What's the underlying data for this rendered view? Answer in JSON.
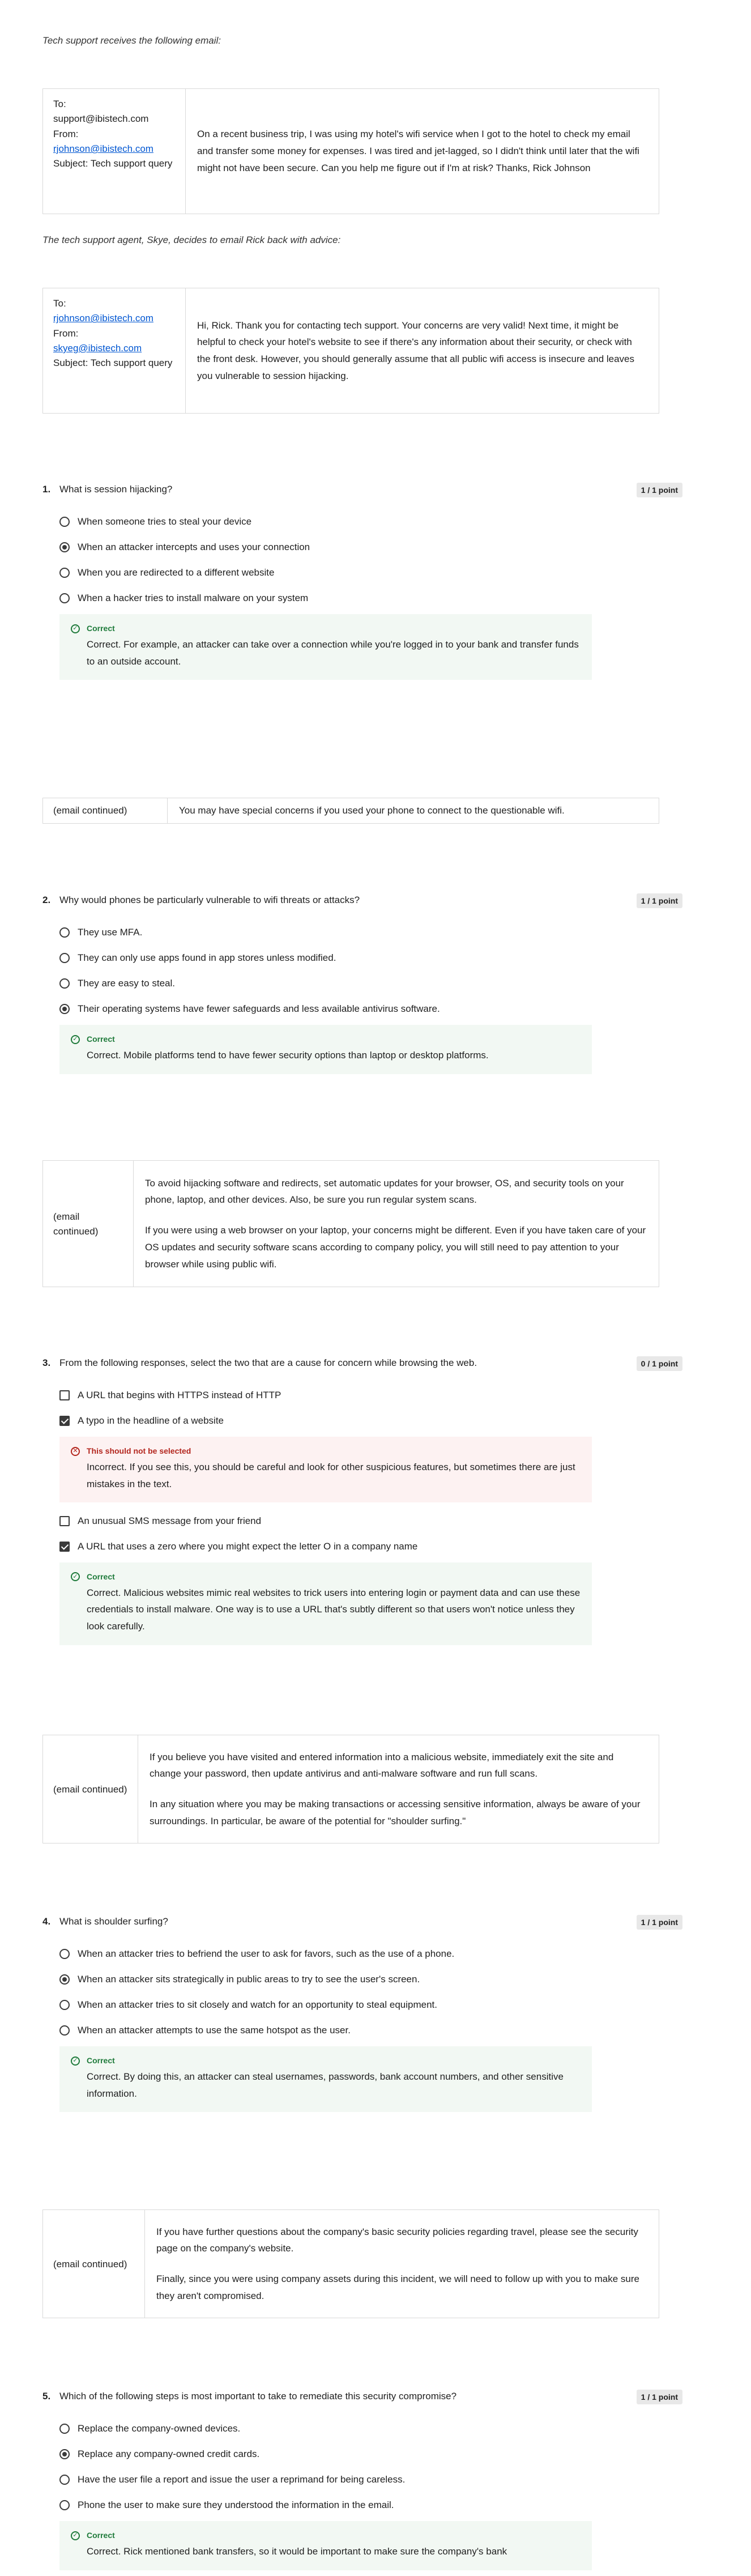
{
  "intro1": "Tech support receives the following email:",
  "email1": {
    "to": "To:",
    "to_addr": "support@ibistech.com",
    "from": "From:",
    "from_addr": "rjohnson@ibistech.com",
    "subject": "Subject: Tech support query",
    "body": "On a recent business trip, I was using my hotel's wifi service when I got to the hotel to check my email and transfer some money for expenses. I was tired and jet-lagged, so I didn't think until later that the wifi might not have been secure. Can you help me figure out if I'm at risk? Thanks, Rick Johnson"
  },
  "intro2": "The tech support agent, Skye, decides to email Rick back with advice:",
  "email2": {
    "to": "To:",
    "to_addr": "rjohnson@ibistech.com",
    "from": "From:",
    "from_addr": "skyeg@ibistech.com",
    "subject": "Subject: Tech support query",
    "body": "Hi, Rick. Thank you for contacting tech support. Your concerns are very valid! Next time, it might be helpful to check your hotel's website to see if there's any information about their security, or check with the front desk. However, you should generally assume that all public wifi access is insecure and leaves you vulnerable to session hijacking."
  },
  "q1": {
    "num": "1.",
    "text": "What is session hijacking?",
    "score": "1 / 1 point",
    "options": [
      "When someone tries to steal your device",
      "When an attacker intercepts and uses your connection",
      "When you are redirected to a different website",
      "When a hacker tries to install malware on your system"
    ],
    "fb_title": "Correct",
    "fb_text": "Correct. For example, an attacker can take over a connection while you're logged in to your bank and transfer funds to an outside account."
  },
  "cont1": {
    "label": "(email continued)",
    "body": "You may have special concerns if you used your phone to connect to the questionable wifi."
  },
  "q2": {
    "num": "2.",
    "text": "Why would phones be particularly vulnerable to wifi threats or attacks?",
    "score": "1 / 1 point",
    "options": [
      "They use MFA.",
      "They can only use apps found in app stores unless modified.",
      "They are easy to steal.",
      "Their operating systems have fewer safeguards and less available antivirus software."
    ],
    "fb_title": "Correct",
    "fb_text": "Correct. Mobile platforms tend to have fewer security options than laptop or desktop platforms."
  },
  "cont2": {
    "label": "(email continued)",
    "p1": "To avoid hijacking software and redirects, set automatic updates for your browser, OS, and security tools on your phone, laptop, and other devices. Also, be sure you run regular system scans.",
    "p2": "If you were using a web browser on your laptop, your concerns might be different. Even if you have taken care of your OS updates and security software scans according to company policy, you will still need to pay attention to your browser while using public wifi."
  },
  "q3": {
    "num": "3.",
    "text": "From the following responses, select the two that are a cause for concern while browsing the web.",
    "score": "0 / 1 point",
    "options": [
      "A URL that begins with HTTPS instead of HTTP",
      "A typo in the headline of a website",
      "An unusual SMS message from your friend",
      "A URL that uses a zero where you might expect the letter O in a company name"
    ],
    "fb1_title": "This should not be selected",
    "fb1_text": "Incorrect. If you see this, you should be careful and look for other suspicious features, but sometimes there are just mistakes in the text.",
    "fb2_title": "Correct",
    "fb2_text": "Correct. Malicious websites mimic real websites to trick users into entering login or payment data and can use these credentials to install malware. One way is to use a URL that's subtly different so that users won't notice unless they look carefully."
  },
  "cont3": {
    "label": "(email continued)",
    "p1": "If you believe you have visited and entered information into a malicious website, immediately exit the site and change your password, then update antivirus and anti-malware software and run full scans.",
    "p2": "In any situation where you may be making transactions or accessing sensitive information, always be aware of your surroundings. In particular, be aware of the potential for \"shoulder surfing.\""
  },
  "q4": {
    "num": "4.",
    "text": "What is shoulder surfing?",
    "score": "1 / 1 point",
    "options": [
      "When an attacker tries to befriend the user to ask for favors, such as the use of a phone.",
      "When an attacker sits strategically in public areas to try to see the user's screen.",
      "When an attacker tries to sit closely and watch for an opportunity to steal equipment.",
      "When an attacker attempts to use the same hotspot as the user."
    ],
    "fb_title": "Correct",
    "fb_text": "Correct. By doing this, an attacker can steal usernames, passwords, bank account numbers, and other sensitive information."
  },
  "cont4": {
    "label": "(email continued)",
    "p1": "If you have further questions about the company's basic security policies regarding travel, please see the security page on the company's website.",
    "p2": "Finally, since you were using company assets during this incident, we will need to follow up with you to make sure they aren't compromised."
  },
  "q5": {
    "num": "5.",
    "text": "Which of the following steps is most important to take to remediate this security compromise?",
    "score": "1 / 1 point",
    "options": [
      "Replace the company-owned devices.",
      "Replace any company-owned credit cards.",
      "Have the user file a report and issue the user a reprimand for being careless.",
      "Phone the user to make sure they understood the information in the email."
    ],
    "fb_title": "Correct",
    "fb_text": "Correct. Rick mentioned bank transfers, so it would be important to make sure the company's bank"
  }
}
